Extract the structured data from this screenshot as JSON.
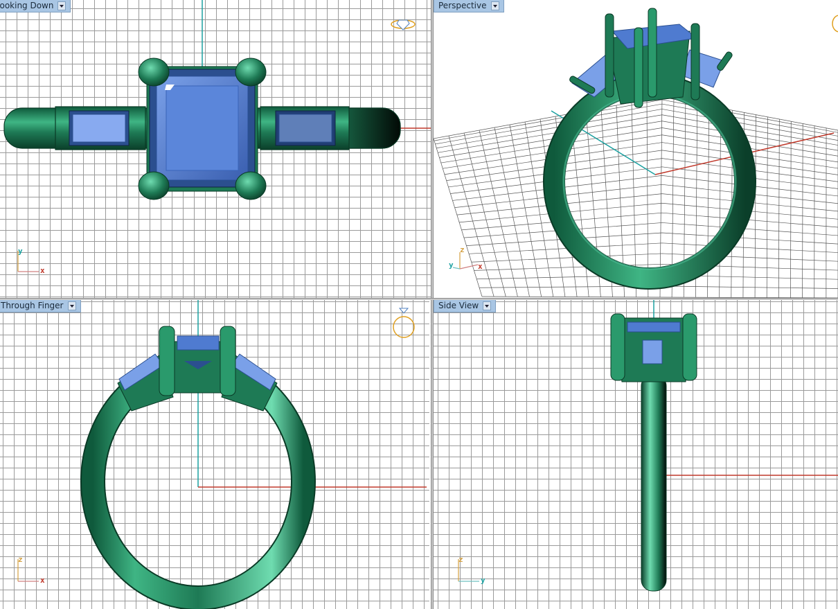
{
  "viewports": {
    "top": {
      "label": "Looking Down",
      "axis_h": "x",
      "axis_v": "y"
    },
    "perspective": {
      "label": "Perspective",
      "axis_h": "x",
      "axis_v": "z",
      "axis_d": "y"
    },
    "front": {
      "label": "Through Finger",
      "axis_h": "x",
      "axis_v": "z"
    },
    "side": {
      "label": "Side View",
      "axis_h": "y",
      "axis_v": "z"
    }
  },
  "colors": {
    "metal": "#1e7a55",
    "metal_light": "#4fc39a",
    "stone": "#4f7bd0",
    "stone_light": "#9cb8ef",
    "axis_x": "#c0392b",
    "axis_y": "#1aa0a0",
    "grid": "#9a9a9a",
    "label_bg": "#a9c6e4"
  },
  "icons": {
    "top_corner": "ring-top-view-icon",
    "perspective_corner": "ring-perspective-icon",
    "front_corner": "ring-front-view-icon"
  }
}
